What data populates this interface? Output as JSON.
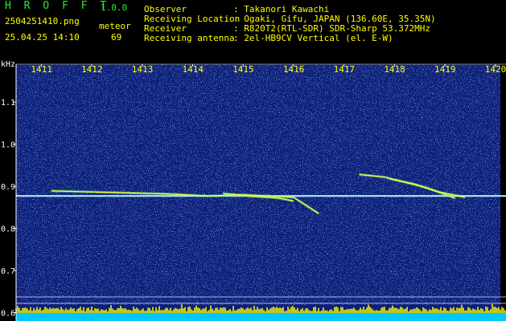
{
  "header": {
    "app_name": "H R O F F T",
    "version": "1.0.0",
    "filename": "2504251410.png",
    "datetime": "25.04.25 14:10",
    "meteor_label": "meteor",
    "meteor_count": "69",
    "info_labels": [
      "Observer",
      "Receiving Location",
      "Receiver",
      "Receiving antenna"
    ],
    "info_values": [
      ": Takanori Kawachi",
      ": Ogaki, Gifu, JAPAN (136.60E, 35.35N)",
      ": R820T2(RTL-SDR) SDR-Sharp 53.372MHz",
      ": 2el-HB9CV Vertical (el. E-W)"
    ]
  },
  "chart_data": {
    "type": "heatmap",
    "title": "",
    "ylabel": "kHz",
    "x_ticks": [
      "1411",
      "1412",
      "1413",
      "1414",
      "1415",
      "1416",
      "1417",
      "1418",
      "1419",
      "1420"
    ],
    "y_ticks": [
      "1.1",
      "1.0",
      "0.9",
      "0.8",
      "0.7",
      "0.6"
    ],
    "ylim": [
      0.58,
      1.19
    ],
    "xlim": [
      1410.5,
      1420.1
    ],
    "carrier_khz": 0.877,
    "meteor_traces": [
      {
        "x": [
          1411.2,
          1413.5,
          1414.3,
          1415.0,
          1416.0,
          1416.5
        ],
        "y": [
          0.889,
          0.882,
          0.877,
          0.88,
          0.874,
          0.835
        ]
      },
      {
        "x": [
          1414.6,
          1415.2,
          1415.7,
          1416.0
        ],
        "y": [
          0.883,
          0.876,
          0.872,
          0.865
        ]
      },
      {
        "x": [
          1417.3,
          1417.8,
          1418.6,
          1419.2
        ],
        "y": [
          0.928,
          0.922,
          0.898,
          0.872
        ]
      },
      {
        "x": [
          1417.9,
          1418.4,
          1418.9,
          1419.4
        ],
        "y": [
          0.918,
          0.905,
          0.886,
          0.874
        ]
      }
    ],
    "colors": {
      "background": "#0d1f78",
      "noise": "#5a8cff",
      "carrier": "#b4f5ff",
      "trace": "#ffff40",
      "spectrum_base": "#00c8ff",
      "spectrum_peak": "#ffff00"
    }
  }
}
